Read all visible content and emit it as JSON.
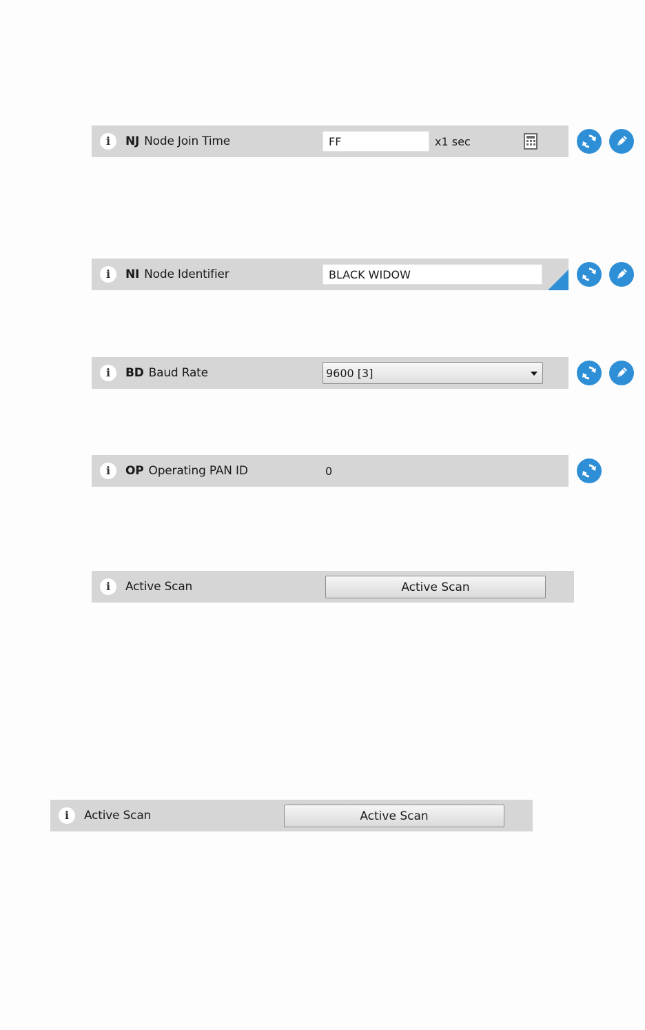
{
  "rows": {
    "nj": {
      "code": "NJ",
      "name": "Node Join Time",
      "value": "FF",
      "unit": "x1 sec"
    },
    "ni": {
      "code": "NI",
      "name": "Node Identifier",
      "value": "BLACK WIDOW"
    },
    "bd": {
      "code": "BD",
      "name": "Baud Rate",
      "selected": "9600 [3]"
    },
    "op": {
      "code": "OP",
      "name": "Operating PAN ID",
      "value": "0"
    },
    "scan1": {
      "name": "Active Scan",
      "button": "Active Scan"
    },
    "scan2": {
      "name": "Active Scan",
      "button": "Active Scan"
    }
  },
  "icons": {
    "info": "info-icon",
    "calculator": "calculator-icon",
    "read": "refresh-icon",
    "write": "pencil-icon"
  },
  "colors": {
    "row_background": "#d6d6d6",
    "accent_blue": "#2f8fd6",
    "page_background": "#fdfdfd"
  }
}
